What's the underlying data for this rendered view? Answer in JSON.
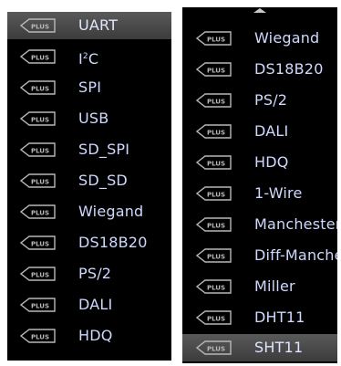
{
  "icon_badge_text": "PLUS",
  "left_panel": {
    "items": [
      {
        "label": "UART",
        "selected": true
      },
      {
        "label_main": "I",
        "label_sup": "2",
        "label_tail": "C"
      },
      {
        "label": "SPI"
      },
      {
        "label": "USB"
      },
      {
        "label": "SD_SPI"
      },
      {
        "label": "SD_SD"
      },
      {
        "label": "Wiegand"
      },
      {
        "label": "DS18B20"
      },
      {
        "label": "PS/2"
      },
      {
        "label": "DALI"
      },
      {
        "label": "HDQ"
      }
    ]
  },
  "right_panel": {
    "items": [
      {
        "label": "Wiegand"
      },
      {
        "label": "DS18B20"
      },
      {
        "label": "PS/2"
      },
      {
        "label": "DALI"
      },
      {
        "label": "HDQ"
      },
      {
        "label": "1-Wire"
      },
      {
        "label": "Manchester"
      },
      {
        "label": "Diff-Manche"
      },
      {
        "label": "Miller"
      },
      {
        "label": "DHT11"
      },
      {
        "label": "SHT11",
        "selected": true
      }
    ]
  },
  "colors": {
    "panel_bg": "#000000",
    "label_text": "#cfd9ff",
    "selected_bg": "#4a4a4a",
    "icon_stroke": "#b8b8b8"
  }
}
